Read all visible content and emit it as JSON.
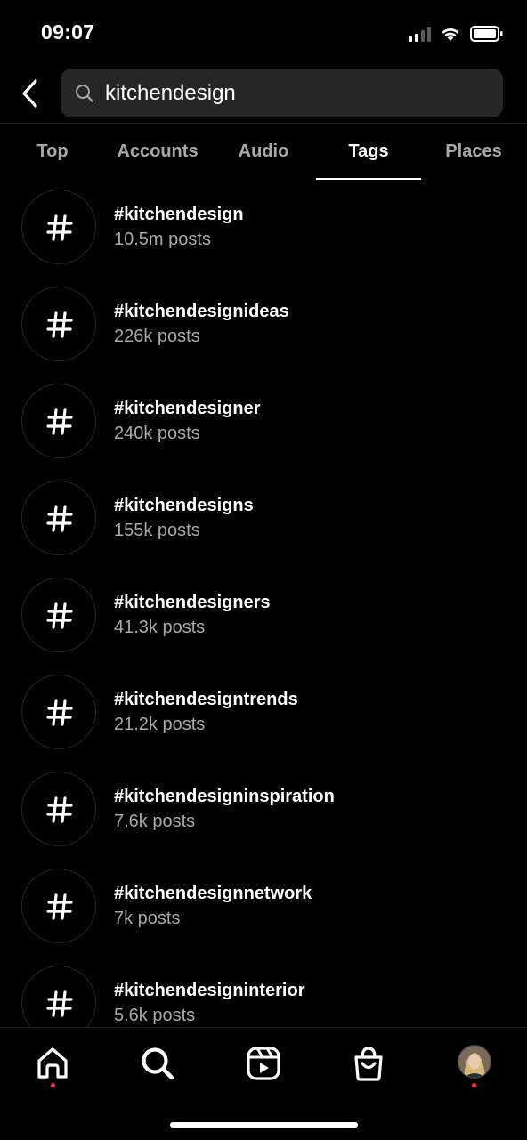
{
  "status_bar": {
    "time": "09:07"
  },
  "search": {
    "query": "kitchendesign"
  },
  "tabs": [
    {
      "label": "Top"
    },
    {
      "label": "Accounts"
    },
    {
      "label": "Audio"
    },
    {
      "label": "Tags"
    },
    {
      "label": "Places"
    }
  ],
  "active_tab": "Tags",
  "results": [
    {
      "tag": "#kitchendesign",
      "count": "10.5m posts"
    },
    {
      "tag": "#kitchendesignideas",
      "count": "226k posts"
    },
    {
      "tag": "#kitchendesigner",
      "count": "240k posts"
    },
    {
      "tag": "#kitchendesigns",
      "count": "155k posts"
    },
    {
      "tag": "#kitchendesigners",
      "count": "41.3k posts"
    },
    {
      "tag": "#kitchendesigntrends",
      "count": "21.2k posts"
    },
    {
      "tag": "#kitchendesigninspiration",
      "count": "7.6k posts"
    },
    {
      "tag": "#kitchendesignnetwork",
      "count": "7k posts"
    },
    {
      "tag": "#kitchendesigninterior",
      "count": "5.6k posts"
    }
  ],
  "icons": {
    "back": "chevron-left-icon",
    "search": "magnifier-icon",
    "result": "hashtag-icon",
    "nav": [
      "home-icon",
      "search-icon",
      "reels-icon",
      "shop-bag-icon",
      "profile-avatar"
    ]
  },
  "colors": {
    "background": "#000000",
    "search_field": "#262626",
    "secondary_text": "#a8a8a8",
    "notification_dot": "#ff3040"
  }
}
